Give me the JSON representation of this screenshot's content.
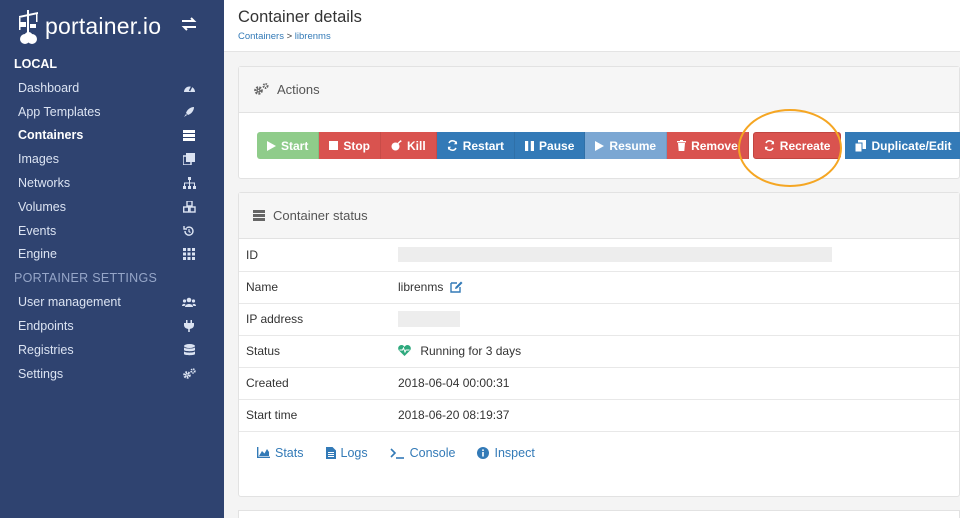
{
  "brand": {
    "name": "portainer.io"
  },
  "sidebar": {
    "local_title": "LOCAL",
    "items": [
      {
        "label": "Dashboard",
        "icon": "dashboard-icon"
      },
      {
        "label": "App Templates",
        "icon": "rocket-icon"
      },
      {
        "label": "Containers",
        "icon": "server-icon",
        "active": true
      },
      {
        "label": "Images",
        "icon": "clone-icon"
      },
      {
        "label": "Networks",
        "icon": "sitemap-icon"
      },
      {
        "label": "Volumes",
        "icon": "cubes-icon"
      },
      {
        "label": "Events",
        "icon": "history-icon"
      },
      {
        "label": "Engine",
        "icon": "th-icon"
      }
    ],
    "settings_title": "PORTAINER SETTINGS",
    "settings_items": [
      {
        "label": "User management",
        "icon": "users-icon"
      },
      {
        "label": "Endpoints",
        "icon": "plug-icon"
      },
      {
        "label": "Registries",
        "icon": "database-icon"
      },
      {
        "label": "Settings",
        "icon": "cogs-icon"
      }
    ]
  },
  "header": {
    "title": "Container details",
    "breadcrumb": {
      "parent": "Containers",
      "separator": ">",
      "current": "librenms"
    }
  },
  "actions": {
    "title": "Actions",
    "buttons": {
      "start": "Start",
      "stop": "Stop",
      "kill": "Kill",
      "restart": "Restart",
      "pause": "Pause",
      "resume": "Resume",
      "remove": "Remove",
      "recreate": "Recreate",
      "duplicate": "Duplicate/Edit"
    }
  },
  "status": {
    "title": "Container status",
    "rows": {
      "id": {
        "label": "ID",
        "value": ""
      },
      "name": {
        "label": "Name",
        "value": "librenms"
      },
      "ip": {
        "label": "IP address",
        "value": ""
      },
      "status": {
        "label": "Status",
        "value": "Running for 3 days"
      },
      "created": {
        "label": "Created",
        "value": "2018-06-04 00:00:31"
      },
      "start_time": {
        "label": "Start time",
        "value": "2018-06-20 08:19:37"
      }
    },
    "links": {
      "stats": "Stats",
      "logs": "Logs",
      "console": "Console",
      "inspect": "Inspect"
    }
  },
  "colors": {
    "sidebar_bg": "#2f4370",
    "link": "#337ab7",
    "danger": "#d9534f",
    "success": "#8fcc8a",
    "highlight_ring": "#f5a623",
    "status_icon": "#2ea97d"
  }
}
